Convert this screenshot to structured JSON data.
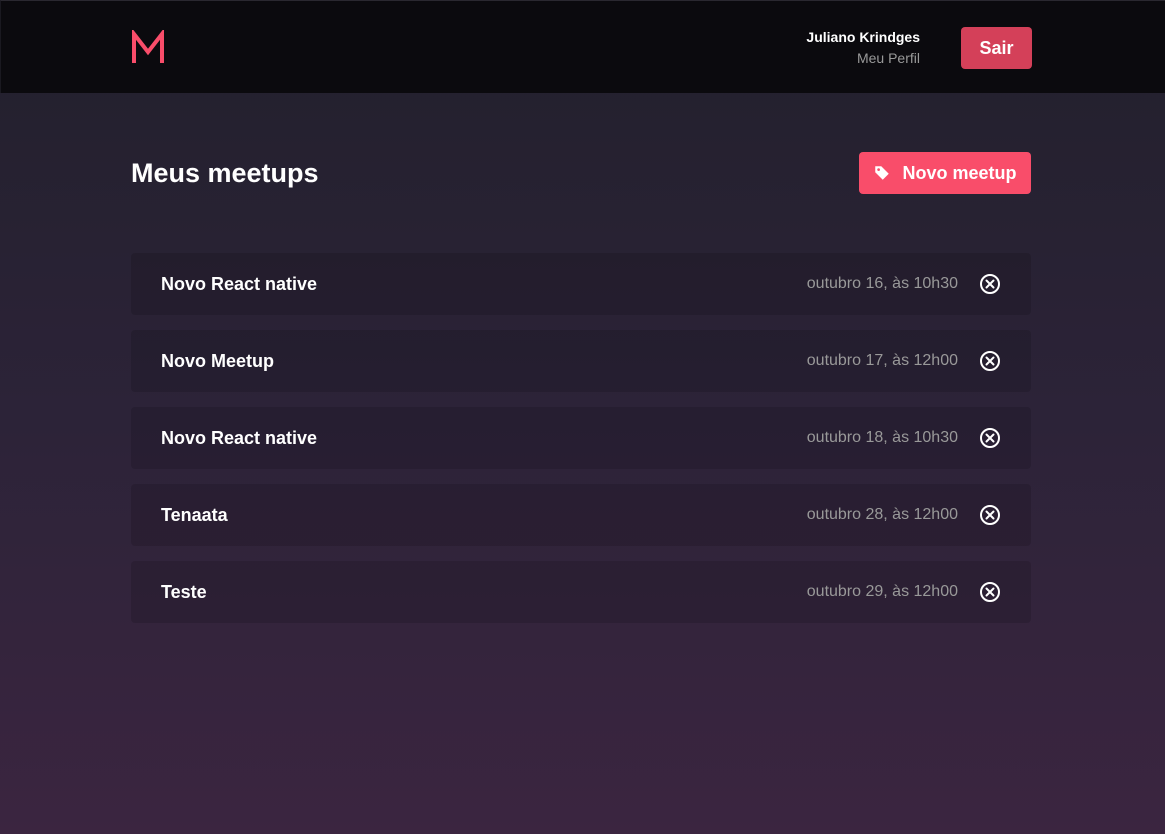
{
  "header": {
    "logo_letter": "M",
    "user_name": "Juliano Krindges",
    "profile_link": "Meu Perfil",
    "logout_label": "Sair"
  },
  "main": {
    "title": "Meus meetups",
    "new_button_label": "Novo meetup",
    "meetups": [
      {
        "title": "Novo React native",
        "date": "outubro 16, às 10h30"
      },
      {
        "title": "Novo Meetup",
        "date": "outubro 17, às 12h00"
      },
      {
        "title": "Novo React native",
        "date": "outubro 18, às 10h30"
      },
      {
        "title": "Tenaata",
        "date": "outubro 28, às 12h00"
      },
      {
        "title": "Teste",
        "date": "outubro 29, às 12h00"
      }
    ]
  },
  "colors": {
    "accent": "#f94d6a",
    "logout": "#d44059",
    "topbar": "#0b0a0e"
  },
  "icons": {
    "logo": "m-logo-icon",
    "new_button": "tag-icon",
    "cancel": "close-circle-icon"
  }
}
